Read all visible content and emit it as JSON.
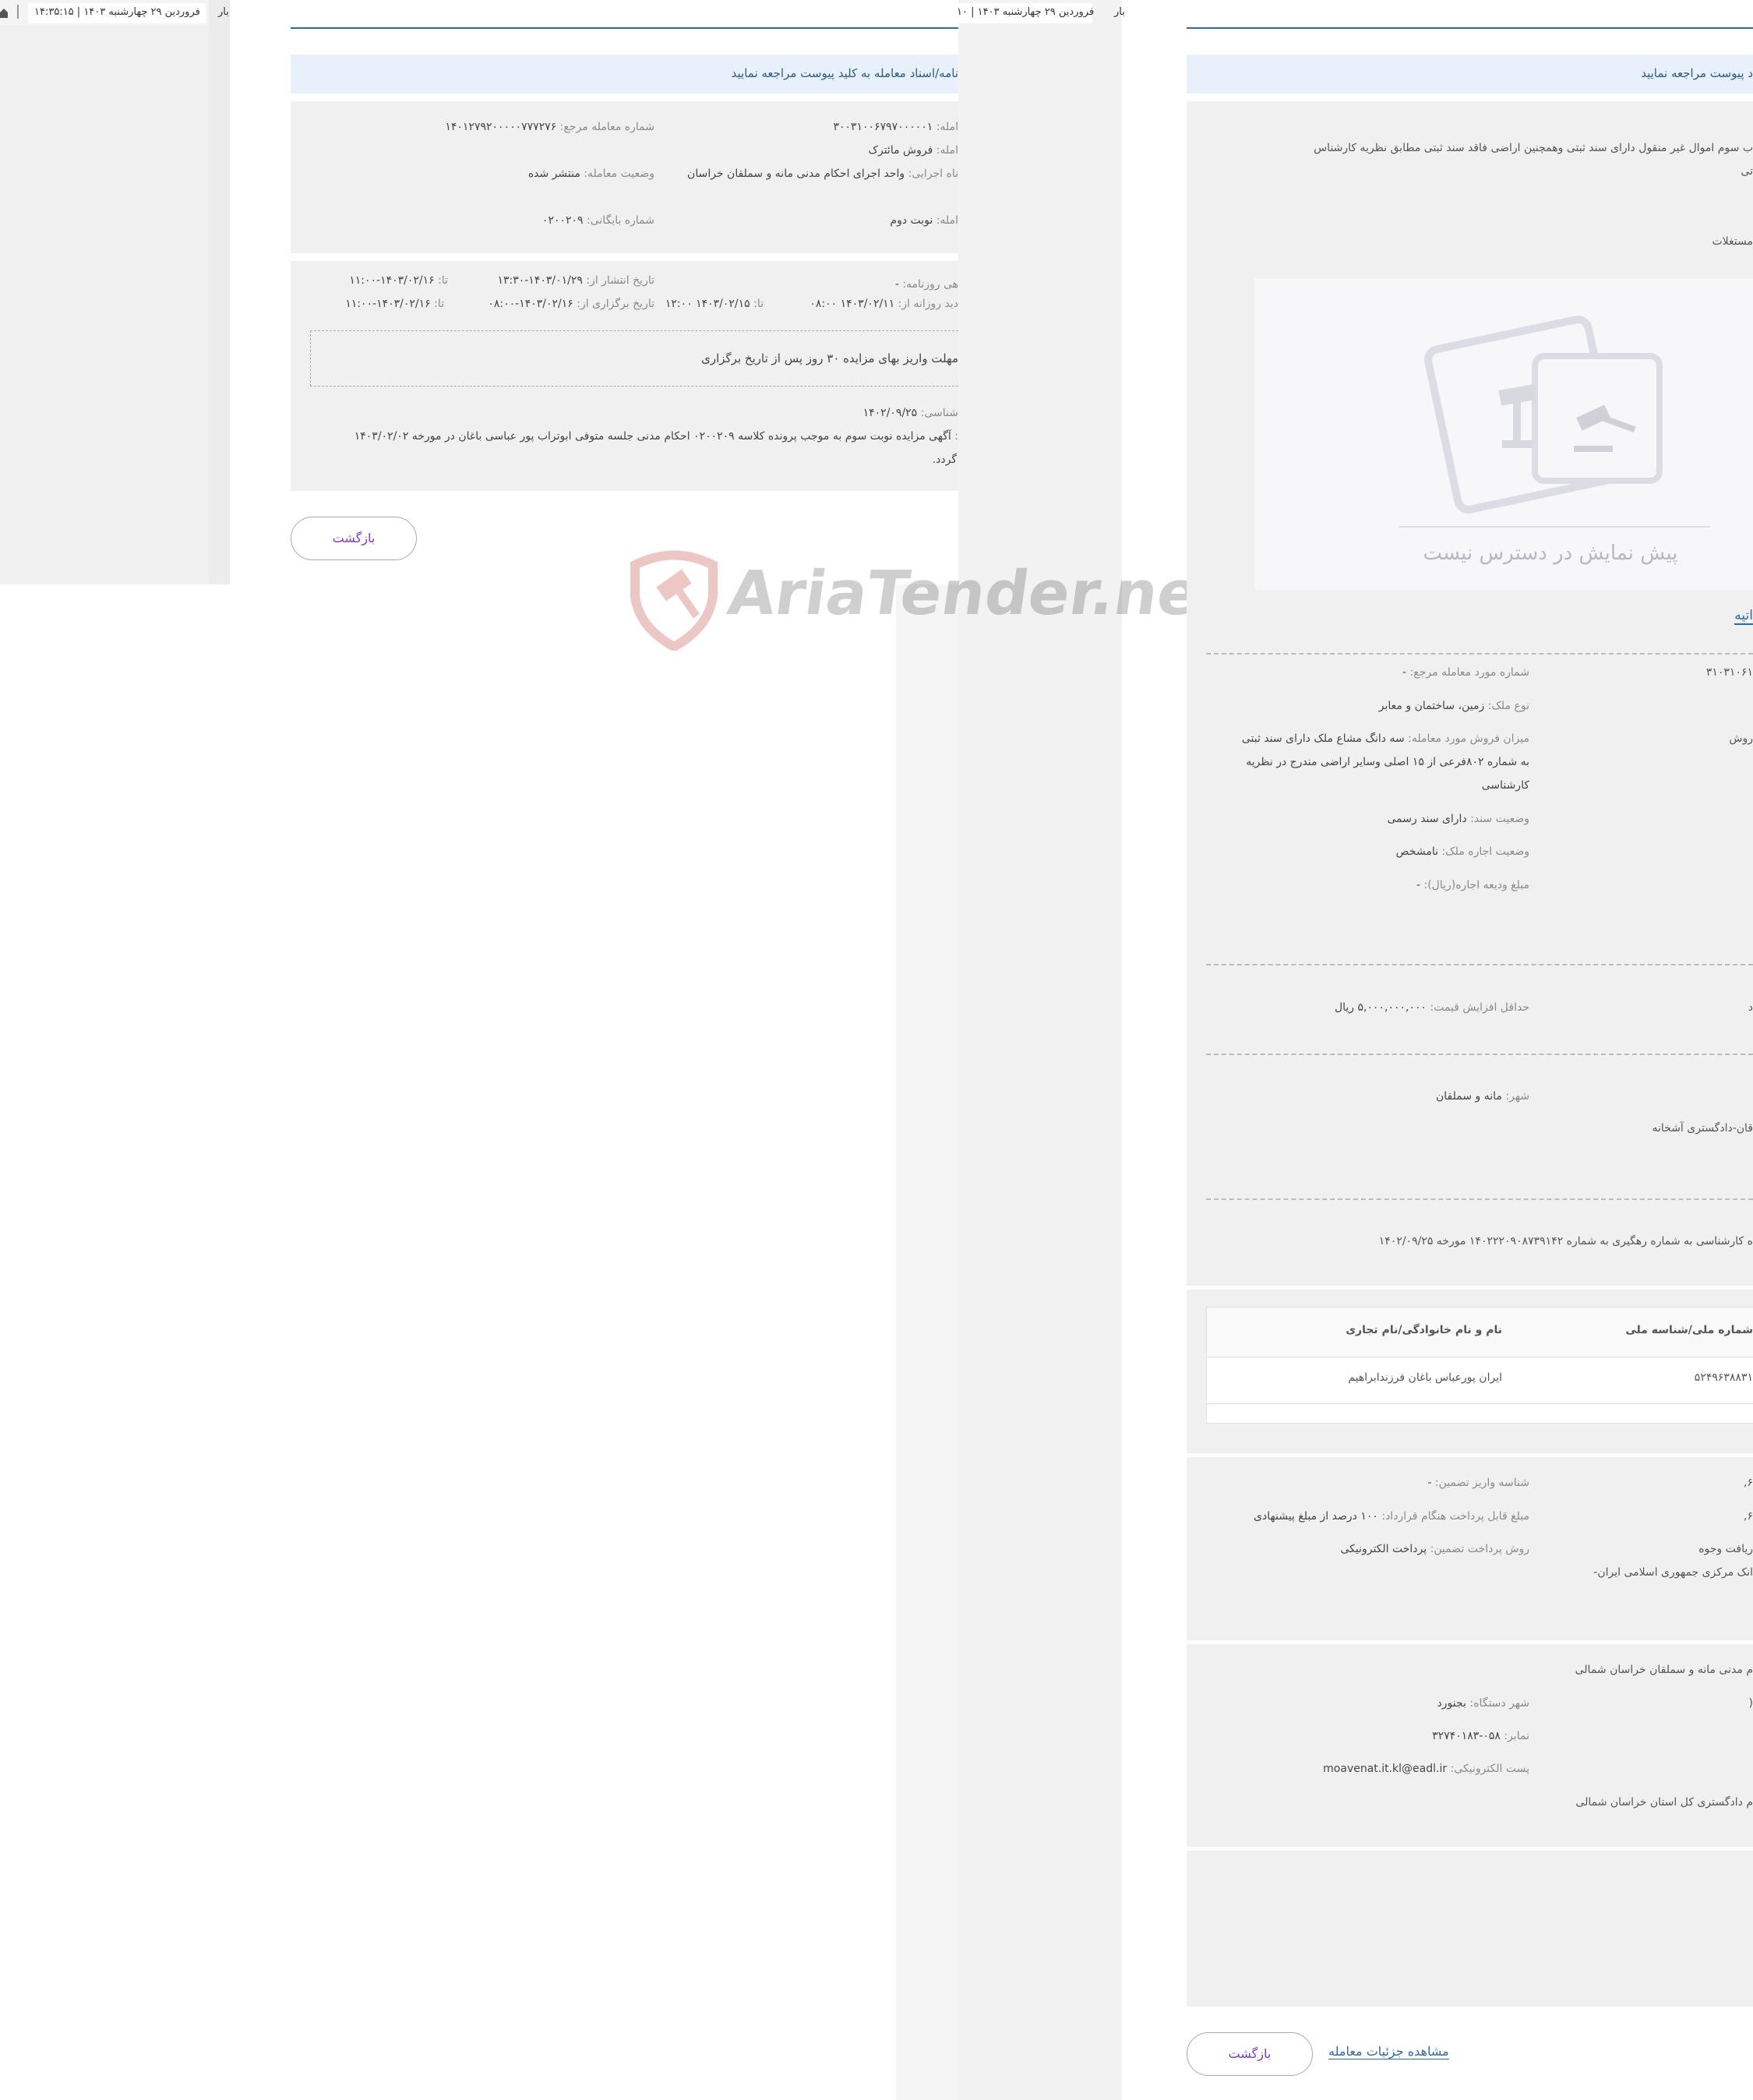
{
  "left_window": {
    "date_time": "فروردین ۲۹ چهارشنبه ۱۴۰۳  |  ۱۴:۳۵:۱۵",
    "partial_label": "بار"
  },
  "middle_window": {
    "date_time": "فروردین ۲۹ چهارشنبه ۱۴۰۳  |  ۱۰",
    "notice": "نامه/اسناد معامله به کلید پیوست مراجعه نمایید",
    "summary": {
      "deal_number_label": "املە:",
      "deal_number": "۳۰۰۳۱۰۰۶۷۹۷۰۰۰۰۰۱",
      "ref_number_label": "شماره معامله مرجع:",
      "ref_number": "۱۴۰۱۲۷۹۲۰۰۰۰۰۷۷۷۲۷۶",
      "deal_type_label": "املە:",
      "deal_type": "فروش مائترک",
      "status_label": "وضعیت معامله:",
      "status": "منتشر شده",
      "exec_unit_label": "ناه اجرایی:",
      "exec_unit": "واحد اجرای احکام مدنی مانه و سملقان خراسان",
      "round_label": "املە:",
      "round": "نوبت دوم",
      "archive_label": "شماره بایگانی:",
      "archive": "۰۲۰۰۲۰۹"
    },
    "dates": {
      "newspaper_label": "هی روزنامه:",
      "newspaper": "-",
      "publish_from_label": "تاریخ انتشار از:",
      "publish_from": "۱۴۰۳/۰۱/۲۹-۱۳:۳۰",
      "publish_to_label": "تا:",
      "publish_to": "۱۴۰۳/۰۲/۱۶-۱۱:۰۰",
      "visit_from_label": "دید روزانه از:",
      "visit_from": "۱۴۰۳/۰۲/۱۱  ۰۸:۰۰",
      "visit_to_label": "تا:",
      "visit_to": "۱۴۰۳/۰۲/۱۵  ۱۲:۰۰",
      "hold_from_label": "تاریخ برگزاری از:",
      "hold_from": "۱۴۰۳/۰۲/۱۶-۰۸:۰۰",
      "hold_to_label": "تا:",
      "hold_to": "۱۴۰۳/۰۲/۱۶-۱۱:۰۰"
    },
    "deposit_box": "مهلت واریز بهای مزایده ۳۰ روز پس از تاریخ برگزاری",
    "expert_date_label": "شناسی:",
    "expert_date": "۱۴۰۲/۰۹/۲۵",
    "description_label": ":",
    "description_line1": "آگهی مزایده نوبت سوم به موجب پرونده کلاسه ۰۲۰۰۲۰۹ احکام مدنی جلسه متوفی ابوتراب پور عباسی باغان در مورخه ۱۴۰۳/۰۲/۰۲",
    "description_line2": "گردد.",
    "back_button": "بازگشت"
  },
  "right_window": {
    "partial_label": "بار",
    "notice": "د پیوست مراجعه نمایید",
    "intro_line1": "ب سوم اموال غیر منقول دارای سند ثبتی وهمچنین اراضی فاقد سند ثبتی مطابق نظریه کارشناس",
    "intro_line2": "تی",
    "category": "مستغلات",
    "no_preview_text": "پیش نمایش در دسترس نیست",
    "tab_label": "اتیه",
    "item_number": "۳۱۰۳۱۰۶۱",
    "ref_item_label": "شماره مورد معامله مرجع:",
    "ref_item": "-",
    "property_type_label": "نوع ملک:",
    "property_type": "زمین، ساختمان و معابر",
    "sale_side": "روش",
    "sale_amount_label": "میزان فروش مورد معامله:",
    "sale_amount_line1": "سه دانگ مشاع ملک دارای سند ثبتی",
    "sale_amount_line2": "به شماره ۸۰۲فرعی از ۱۵ اصلی وسایر اراضی مندرج در نظریه",
    "sale_amount_line3": "کارشناسی",
    "deed_status_label": "وضعیت سند:",
    "deed_status": "دارای سند رسمی",
    "lease_status_label": "وضعیت اجاره ملک:",
    "lease_status": "نامشخص",
    "lease_deposit_label": "مبلغ ودیعه اجاره(ریال):",
    "lease_deposit": "-",
    "min_increase_side": "د",
    "min_increase_label": "حداقل افزایش قیمت:",
    "min_increase": "۵,۰۰۰,۰۰۰,۰۰۰ ریال",
    "city_label": "شهر:",
    "city": "مانه و سملقان",
    "location": "قان-دادگستری آشخانه",
    "expert_note": "ه کارشناسی به شماره رهگیری به شماره ۱۴۰۲۲۲۰۹۰۸۷۳۹۱۴۲ مورخه ۱۴۰۲/۰۹/۲۵",
    "table": {
      "col_national_id": "شماره ملی/شناسه ملی",
      "col_name": "نام و نام خانوادگی/نام تجاری",
      "row_id": "۵۲۴۹۶۳۸۸۳۱",
      "row_name": "ایران پورعباس باغان فرزندابراهیم"
    },
    "payment": {
      "guarantee_id_label": "شناسه واریز تضمین:",
      "guarantee_id": "-",
      "contract_pay_label": "مبلغ قابل پرداخت هنگام قرارداد:",
      "contract_pay": "۱۰۰ درصد از مبلغ پیشنهادی",
      "guarantee_method_label": "روش پرداخت تضمین:",
      "guarantee_method": "پرداخت الکترونیکی",
      "side_value_1": "۶,",
      "side_value_2": "۶,",
      "side_receive": "ریافت وجوه",
      "side_bank": "انک مرکزی جمهوری اسلامی ایران-"
    },
    "contact": {
      "org": "م مدنی مانه و سملقان خراسان شمالی",
      "device_city_label": "شهر دستگاه:",
      "device_city": "بجنورد",
      "fax_label": "نمابر:",
      "fax": "۰۵۸-۳۲۷۴۰۱۸۳",
      "email_label": "پست الکترونیکی:",
      "email": "moavenat.it.kl@eadl.ir",
      "side_value": "(",
      "parent_org": "م دادگستری کل استان خراسان شمالی"
    },
    "view_details_link": "مشاهده جزئیات معامله",
    "back_button": "بازگشت"
  },
  "watermark": "AriaTender.neT"
}
